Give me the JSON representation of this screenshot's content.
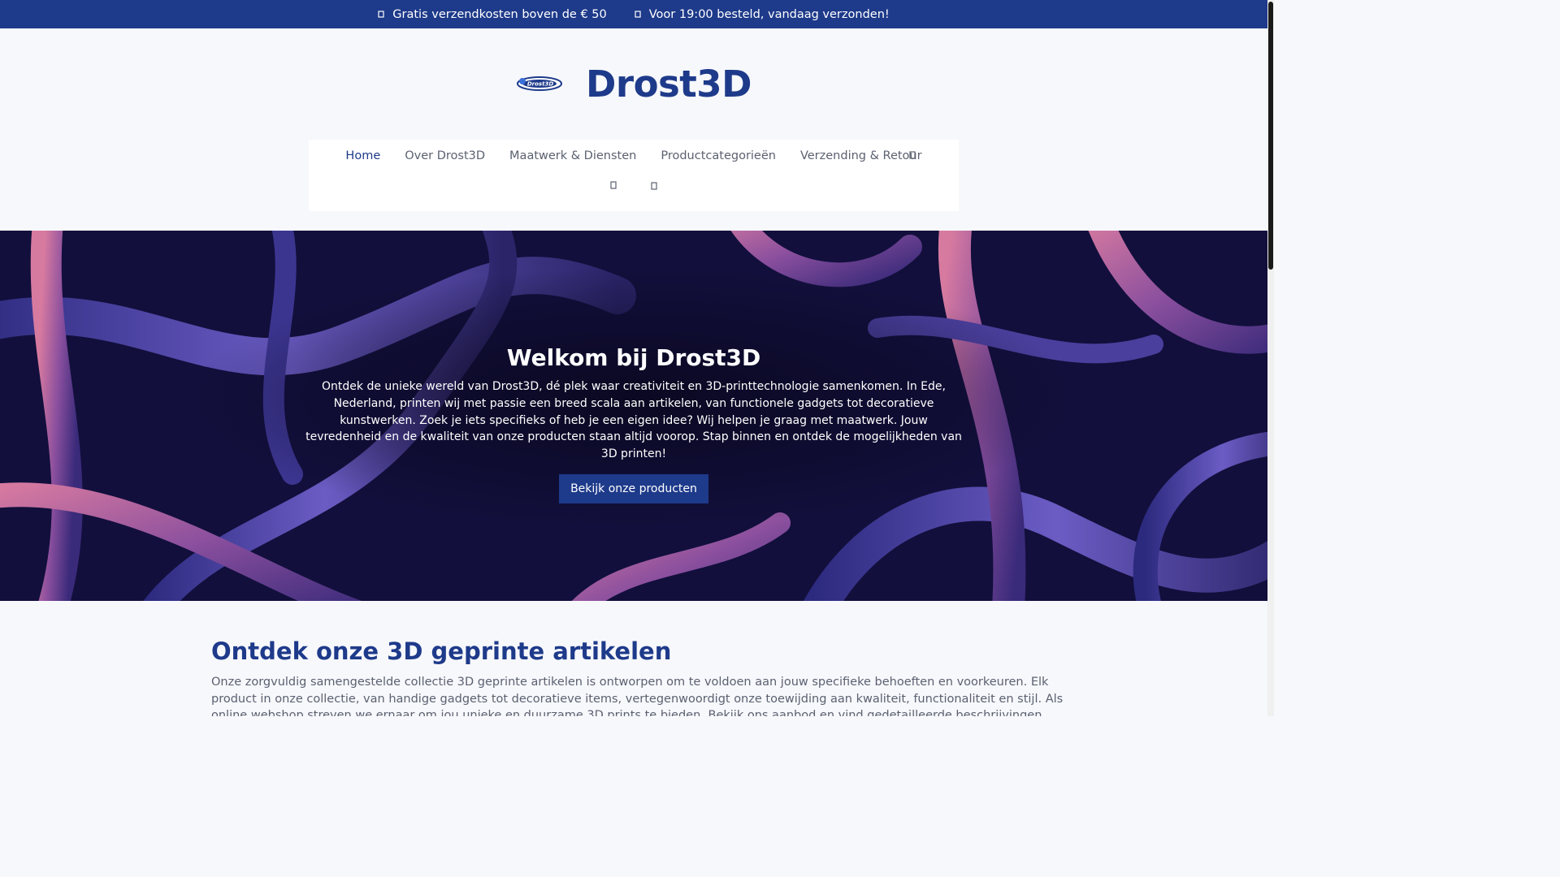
{
  "topbar": {
    "items": [
      {
        "text": "Gratis verzendkosten boven de € 50",
        "icon": "truck-icon"
      },
      {
        "text": "Voor 19:00 besteld, vandaag verzonden!",
        "icon": "clock-icon"
      }
    ]
  },
  "header": {
    "logo_text": "Drost3D",
    "site_title": "Drost3D"
  },
  "nav": {
    "items": [
      {
        "label": "Home",
        "active": true
      },
      {
        "label": "Over Drost3D",
        "active": false
      },
      {
        "label": "Maatwerk & Diensten",
        "active": false
      },
      {
        "label": "Productcategorieën",
        "active": false
      },
      {
        "label": "Verzending & Retour",
        "active": false
      }
    ],
    "icons": [
      "user-icon",
      "search-icon",
      "cart-icon"
    ]
  },
  "hero": {
    "title": "Welkom bij Drost3D",
    "text": "Ontdek de unieke wereld van Drost3D, dé plek waar creativiteit en 3D-printtechnologie samenkomen. In Ede, Nederland, printen wij met passie een breed scala aan artikelen, van functionele gadgets tot decoratieve kunstwerken. Zoek je iets specifieks of heb je een eigen idee? Wij helpen je graag met maatwerk. Jouw tevredenheid en de kwaliteit van onze producten staan altijd voorop. Stap binnen en ontdek de mogelijkheden van 3D printen!",
    "button_label": "Bekijk onze producten"
  },
  "section": {
    "title": "Ontdek onze 3D geprinte artikelen",
    "text": "Onze zorgvuldig samengestelde collectie 3D geprinte artikelen is ontworpen om te voldoen aan jouw specifieke behoeften en voorkeuren. Elk product in onze collectie, van handige gadgets tot decoratieve items, vertegenwoordigt onze toewijding aan kwaliteit, functionaliteit en stijl. Als online webshop streven we ernaar om jou unieke en duurzame 3D prints te bieden. Bekijk ons aanbod en vind gedetailleerde beschrijvingen, functies en specificaties waarmee je"
  },
  "colors": {
    "brand": "#1e3a8a",
    "background": "#f7f8fc",
    "hero_dark": "#0d0b30",
    "hero_pink": "#c06a8c",
    "hero_blue": "#5a4fb0"
  }
}
